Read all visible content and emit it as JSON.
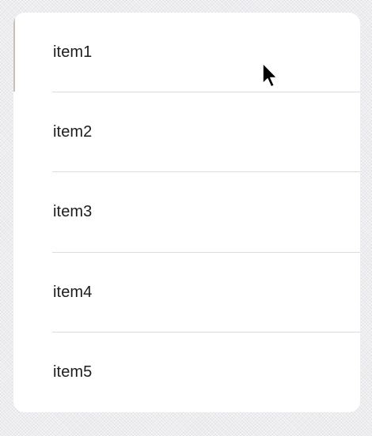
{
  "list": {
    "items": [
      {
        "label": "item1"
      },
      {
        "label": "item2"
      },
      {
        "label": "item3"
      },
      {
        "label": "item4"
      },
      {
        "label": "item5"
      }
    ]
  },
  "cursor": {
    "icon": "arrow-pointer-icon"
  }
}
